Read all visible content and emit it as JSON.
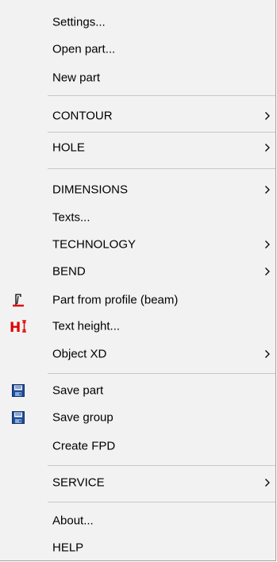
{
  "menu": {
    "items": [
      {
        "label": "Settings..."
      },
      {
        "label": "Open part..."
      },
      {
        "label": "New part"
      },
      {
        "label": "CONTOUR",
        "submenu_arrow": ">"
      },
      {
        "label": "HOLE",
        "submenu_arrow": ">"
      },
      {
        "label": "DIMENSIONS",
        "submenu_arrow": ">"
      },
      {
        "label": "Texts..."
      },
      {
        "label": "TECHNOLOGY",
        "submenu_arrow": ">"
      },
      {
        "label": "BEND",
        "submenu_arrow": ">"
      },
      {
        "label": "Part from profile (beam)",
        "icon": "profile-beam-icon"
      },
      {
        "label": "Text height...",
        "icon": "text-height-icon"
      },
      {
        "label": "Object XD",
        "submenu_arrow": ">"
      },
      {
        "label": "Save part",
        "icon": "floppy-disk-icon"
      },
      {
        "label": "Save group",
        "icon": "floppy-disk-icon"
      },
      {
        "label": "Create FPD"
      },
      {
        "label": "SERVICE",
        "submenu_arrow": ">"
      },
      {
        "label": "About..."
      },
      {
        "label": "HELP"
      }
    ]
  },
  "colors": {
    "menu_background": "#f2f2f2",
    "separator": "#c8c8c8",
    "icon_red": "#e00000",
    "icon_blue": "#1f4e9c"
  }
}
